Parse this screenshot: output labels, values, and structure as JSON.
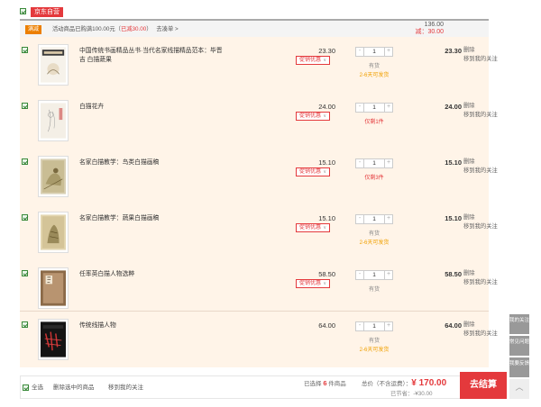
{
  "shop": {
    "name": "京东自营"
  },
  "promo": {
    "tag": "满减",
    "text_before": "活动商品已购满100.00元（",
    "text_reduced": "已减30.00",
    "text_after": "）",
    "link": "去凑单 >",
    "total": "136.00",
    "discount": "减：30.00"
  },
  "items": [
    {
      "title": "中国传统书画精品丛书·当代名家线描精品范本：毕晋吉 白描蔬果",
      "price": "23.30",
      "promo": "促销优惠",
      "qty": "1",
      "stock": "有货",
      "ship": "2-6天可发货",
      "subtotal": "23.30",
      "op_delete": "删除",
      "op_follow": "移到我的关注"
    },
    {
      "title": "白描花卉",
      "price": "24.00",
      "promo": "促销优惠",
      "qty": "1",
      "stock": "仅剩1件",
      "ship": "",
      "subtotal": "24.00",
      "op_delete": "删除",
      "op_follow": "移到我的关注"
    },
    {
      "title": "名家白描教学：鸟类白描画稿",
      "price": "15.10",
      "promo": "促销优惠",
      "qty": "1",
      "stock": "仅剩3件",
      "ship": "",
      "subtotal": "15.10",
      "op_delete": "删除",
      "op_follow": "移到我的关注"
    },
    {
      "title": "名家白描教学：蔬果白描画稿",
      "price": "15.10",
      "promo": "促销优惠",
      "qty": "1",
      "stock": "有货",
      "ship": "2-6天可发货",
      "subtotal": "15.10",
      "op_delete": "删除",
      "op_follow": "移到我的关注"
    },
    {
      "title": "任率英白描人物选粹",
      "price": "58.50",
      "promo": "促销优惠",
      "qty": "1",
      "stock": "有货",
      "ship": "",
      "subtotal": "58.50",
      "op_delete": "删除",
      "op_follow": "移到我的关注"
    },
    {
      "title": "传统线描人物",
      "price": "64.00",
      "promo": "",
      "qty": "1",
      "stock": "有货",
      "ship": "2-6天可发货",
      "subtotal": "64.00",
      "op_delete": "删除",
      "op_follow": "移到我的关注"
    }
  ],
  "float_bar": {
    "follow": "我的关注",
    "faq": "常见问题",
    "feedback": "我要反馈"
  },
  "footer": {
    "select_all": "全选",
    "delete_selected": "删除选中的商品",
    "move_follow": "移到我的关注",
    "selected_prefix": "已选择",
    "selected_count": "6",
    "selected_suffix": "件商品",
    "total_label": "总价（不含运费）：",
    "total_amount": "¥ 170.00",
    "saved": "已节省：-¥30.00",
    "checkout": "去结算"
  },
  "colors": {
    "accent": "#e4393c",
    "promo_bg": "#fff4e8",
    "promo_tag": "#ec7f00"
  }
}
